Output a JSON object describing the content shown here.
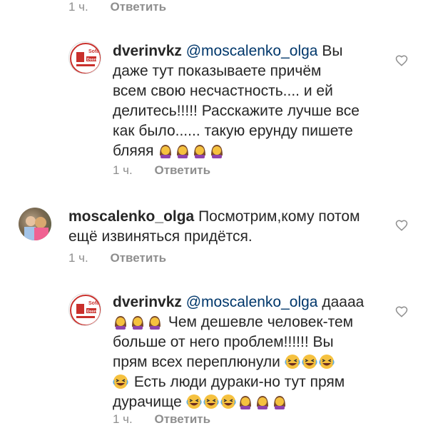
{
  "comments": [
    {
      "username": "",
      "text": "",
      "time": "1 ч.",
      "reply": "Ответить"
    },
    {
      "username": "dverinvkz",
      "mention": "@moscalenko_olga",
      "text_lines": [
        "Вы",
        "даже тут показываете причём",
        "всем свою несчастность.... и ей",
        "делитесь!!!!! Расскажите лучше все",
        "как было...... такую ерунду пишете",
        "бляяя"
      ],
      "emojis": [
        "woman-emoji",
        "woman-emoji",
        "woman-emoji",
        "woman-emoji"
      ],
      "time": "1 ч.",
      "reply": "Ответить"
    },
    {
      "username": "moscalenko_olga",
      "text_lines": [
        "Посмотрим,кому потом",
        "ещё извиняться придётся."
      ],
      "time": "1 ч.",
      "reply": "Ответить"
    },
    {
      "username": "dverinvkz",
      "mention": "@moscalenko_olga",
      "text_lines": [
        "даааа",
        "Чем дешевле человек-тем",
        "больше от него проблем!!!!!! Вы",
        "прям всех переплюнули",
        "Есть люди дураки-но тут прям",
        "дурачище"
      ],
      "time": "1 ч.",
      "reply": "Ответить"
    }
  ],
  "colors": {
    "text": "#262626",
    "meta": "#8e8e8e",
    "mention": "#00376b",
    "heart": "#8e8e8e"
  },
  "avatar_logo_text": [
    "Sofa",
    "Doors"
  ]
}
